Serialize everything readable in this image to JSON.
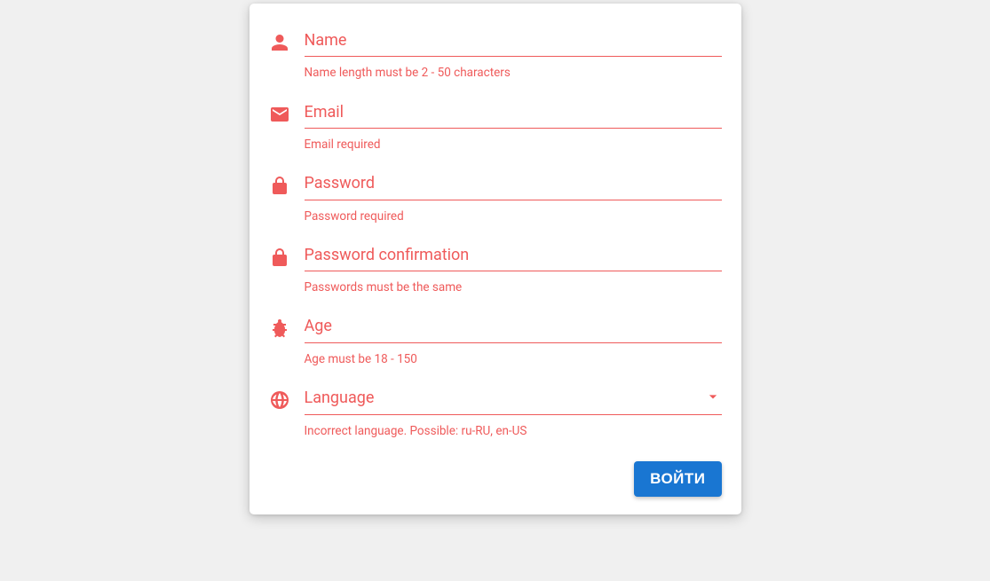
{
  "colors": {
    "error": "#ef5a5a",
    "primary": "#1976d2"
  },
  "form": {
    "fields": [
      {
        "id": "name",
        "label": "Name",
        "hint": "Name length must be 2 - 50 characters",
        "icon": "person-icon",
        "type": "text",
        "has_caret": false
      },
      {
        "id": "email",
        "label": "Email",
        "hint": "Email required",
        "icon": "mail-icon",
        "type": "text",
        "has_caret": false
      },
      {
        "id": "password",
        "label": "Password",
        "hint": "Password required",
        "icon": "lock-icon",
        "type": "password",
        "has_caret": false
      },
      {
        "id": "password2",
        "label": "Password confirmation",
        "hint": "Passwords must be the same",
        "icon": "lock-icon",
        "type": "password",
        "has_caret": false
      },
      {
        "id": "age",
        "label": "Age",
        "hint": "Age must be 18 - 150",
        "icon": "bug-icon",
        "type": "text",
        "has_caret": false
      },
      {
        "id": "language",
        "label": "Language",
        "hint": "Incorrect language. Possible: ru-RU, en-US",
        "icon": "globe-icon",
        "type": "select",
        "has_caret": true
      }
    ],
    "submit_label": "ВОЙТИ"
  }
}
